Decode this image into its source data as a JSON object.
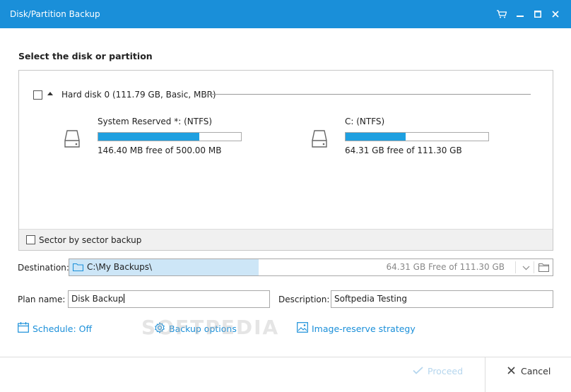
{
  "window": {
    "title": "Disk/Partition Backup"
  },
  "section_title": "Select the disk or partition",
  "disk": {
    "label": "Hard disk 0 (111.79 GB, Basic, MBR)",
    "partitions": [
      {
        "name": "System Reserved *: (NTFS)",
        "free": "146.40 MB free of 500.00 MB",
        "used_fraction": 0.71
      },
      {
        "name": "C: (NTFS)",
        "free": "64.31 GB free of 111.30 GB",
        "used_fraction": 0.42
      }
    ]
  },
  "sector_backup_label": "Sector by sector backup",
  "destination": {
    "label": "Destination:",
    "path": "C:\\My Backups\\",
    "free": "64.31 GB Free of 111.30 GB"
  },
  "plan": {
    "label": "Plan name:",
    "value": "Disk Backup"
  },
  "description": {
    "label": "Description:",
    "value": "Softpedia Testing"
  },
  "links": {
    "schedule": "Schedule: Off",
    "backup_options": "Backup options",
    "image_strategy": "Image-reserve strategy"
  },
  "watermark": "SOFTPEDIA",
  "buttons": {
    "proceed": "Proceed",
    "cancel": "Cancel"
  },
  "colors": {
    "titlebar": "#1a8fd9",
    "bar_fill": "#1ea0e0",
    "link": "#1a8fd9"
  }
}
